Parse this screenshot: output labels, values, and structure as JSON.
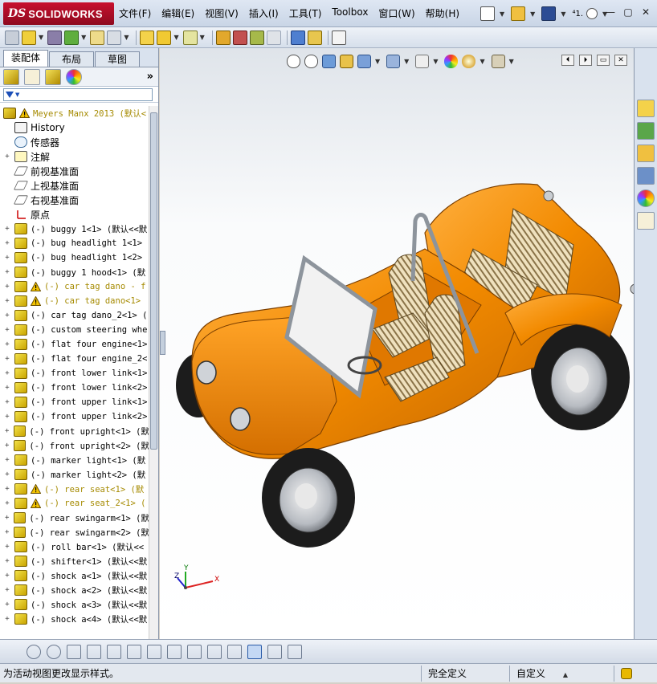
{
  "app": {
    "logo_text": "SOLIDWORKS",
    "logo_mark": "DS"
  },
  "menu": [
    "文件(F)",
    "编辑(E)",
    "视图(V)",
    "插入(I)",
    "工具(T)",
    "Toolbox",
    "窗口(W)",
    "帮助(H)"
  ],
  "title_tools": {
    "version_glyph": "⁴1."
  },
  "window_controls": {
    "minimize": "—",
    "restore": "▢",
    "close": "✕"
  },
  "tabs": [
    "装配体",
    "布局",
    "草图"
  ],
  "feature_manager": {
    "expand_glyph": "»",
    "filter_glyph": "▼",
    "root": "Meyers Manx 2013 (默认<",
    "system_items": [
      {
        "label": "History",
        "icon": "history-icon"
      },
      {
        "label": "传感器",
        "icon": "sensor-icon"
      },
      {
        "label": "注解",
        "icon": "annotation-icon",
        "expandable": true
      },
      {
        "label": "前视基准面",
        "icon": "plane-icon"
      },
      {
        "label": "上视基准面",
        "icon": "plane-icon"
      },
      {
        "label": "右视基准面",
        "icon": "plane-icon"
      },
      {
        "label": "原点",
        "icon": "origin-icon"
      }
    ],
    "components": [
      {
        "label": "(-) buggy 1<1> (默认<<默",
        "warn": false
      },
      {
        "label": "(-) bug headlight 1<1>",
        "warn": false
      },
      {
        "label": "(-) bug headlight 1<2>",
        "warn": false
      },
      {
        "label": "(-) buggy 1 hood<1> (默",
        "warn": false
      },
      {
        "label": "(-) car tag dano - f",
        "warn": true
      },
      {
        "label": "(-) car tag dano<1>",
        "warn": true
      },
      {
        "label": "(-) car tag dano_2<1> (",
        "warn": false
      },
      {
        "label": "(-) custom steering whe",
        "warn": false
      },
      {
        "label": "(-) flat four engine<1>",
        "warn": false
      },
      {
        "label": "(-) flat four engine_2<",
        "warn": false
      },
      {
        "label": "(-) front lower link<1>",
        "warn": false
      },
      {
        "label": "(-) front lower link<2>",
        "warn": false
      },
      {
        "label": "(-) front upper link<1>",
        "warn": false
      },
      {
        "label": "(-) front upper link<2>",
        "warn": false
      },
      {
        "label": "(-) front upright<1> (默",
        "warn": false
      },
      {
        "label": "(-) front upright<2> (默",
        "warn": false
      },
      {
        "label": "(-) marker light<1> (默",
        "warn": false
      },
      {
        "label": "(-) marker light<2> (默",
        "warn": false
      },
      {
        "label": "(-) rear seat<1> (默",
        "warn": true
      },
      {
        "label": "(-) rear seat_2<1> (",
        "warn": true
      },
      {
        "label": "(-) rear swingarm<1> (默",
        "warn": false
      },
      {
        "label": "(-) rear swingarm<2> (默",
        "warn": false
      },
      {
        "label": "(-) roll bar<1> (默认<<",
        "warn": false
      },
      {
        "label": "(-) shifter<1> (默认<<默",
        "warn": false
      },
      {
        "label": "(-) shock a<1> (默认<<默",
        "warn": false
      },
      {
        "label": "(-) shock a<2> (默认<<默",
        "warn": false
      },
      {
        "label": "(-) shock a<3> (默认<<默",
        "warn": false
      },
      {
        "label": "(-) shock a<4> (默认<<默",
        "warn": false
      }
    ]
  },
  "triad": {
    "x": "X",
    "y": "Y",
    "z": "Z"
  },
  "status": {
    "message": "为活动视图更改显示样式。",
    "defined": "完全定义",
    "units": "自定义",
    "units_caret": "▲"
  },
  "colors": {
    "body": "#f28a00",
    "body_dark": "#b85a00",
    "tire": "#1a1a1a",
    "seat": "#e8d7b0",
    "frame": "#9aa0a6",
    "accent": "#2a5ba8",
    "warn": "#f2c200"
  }
}
